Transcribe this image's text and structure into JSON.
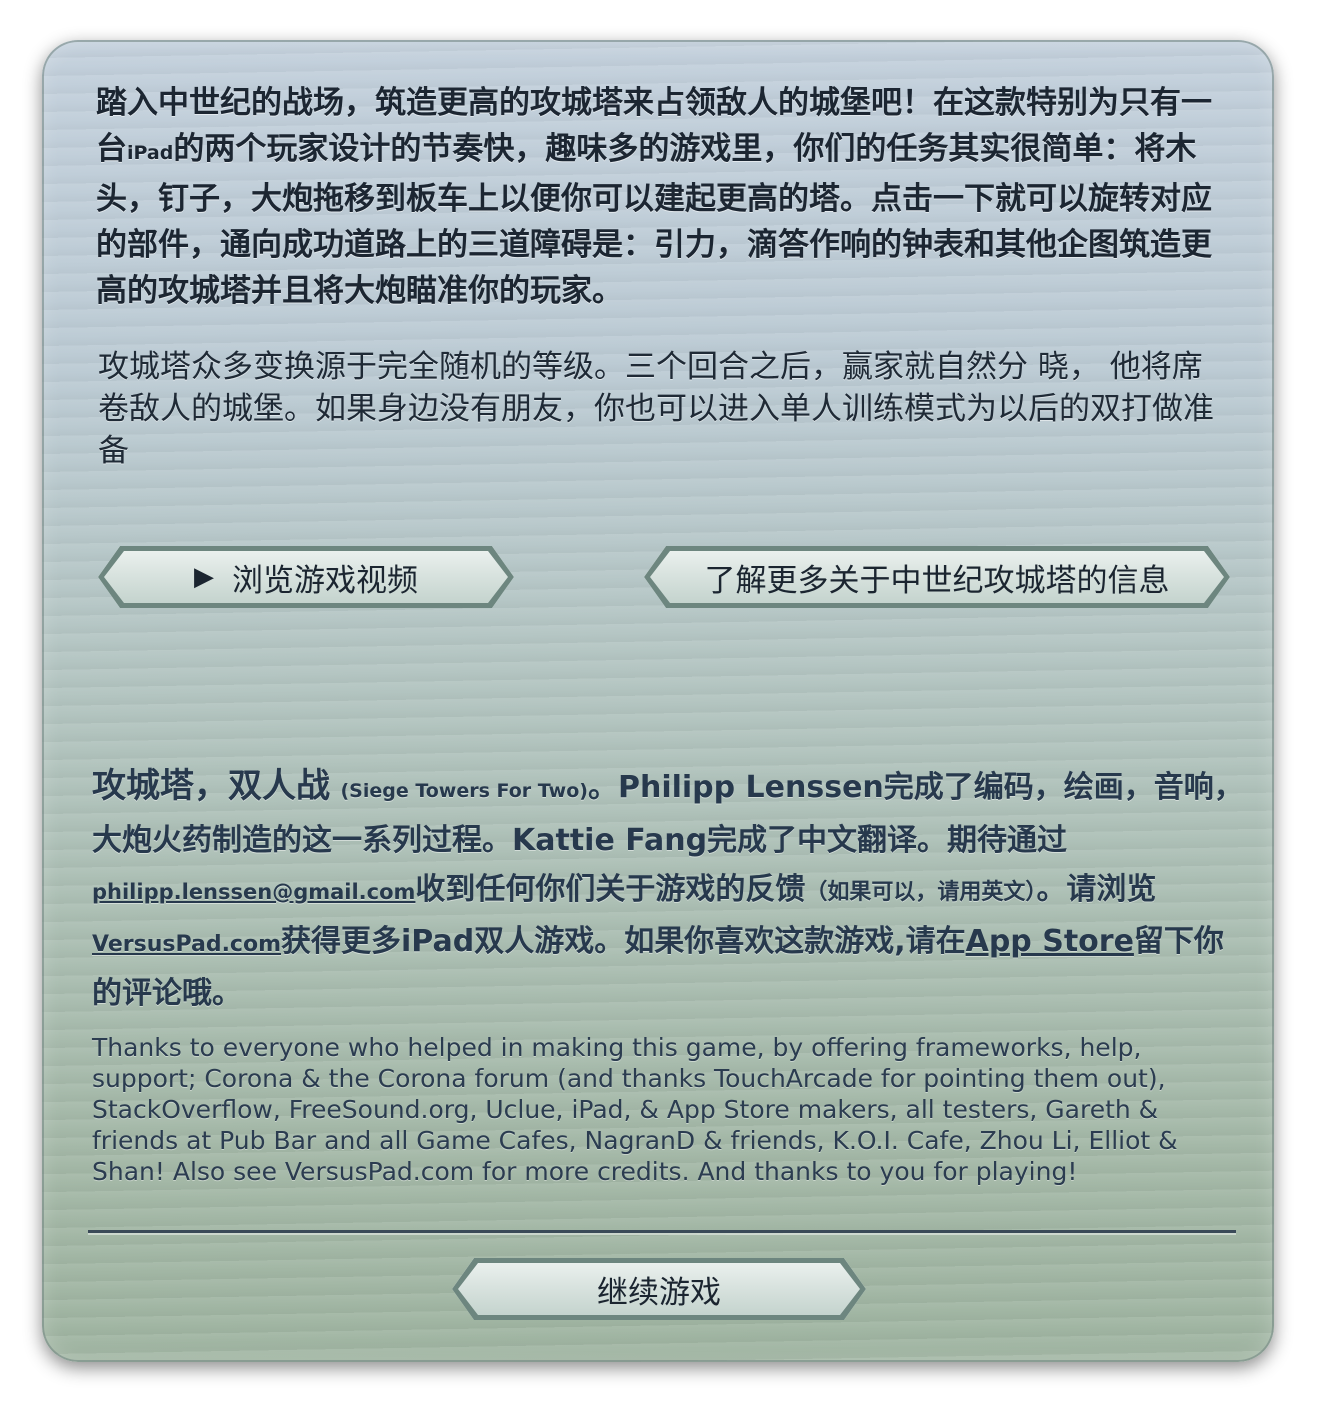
{
  "intro": {
    "bold_part1": "踏入中世纪的战场，筑造更高的攻城塔来占领敌人的城堡吧！在这款特别为只有一台",
    "bold_ipad": "iPad",
    "bold_part2": "的两个玩家设计的节奏快，趣味多的游戏里，你们的任务其实很简单：将木头，钉子，大炮拖移到板车上以便你可以建起更高的塔。点击一下就可以旋转对应的部件，通向成功道路上的三道障碍是：引力，滴答作响的钟表和其他企图筑造更高的攻城塔并且将大炮瞄准你的玩家。",
    "regular": "攻城塔众多变换源于完全随机的等级。三个回合之后，赢家就自然分 晓， 他将席卷敌人的城堡。如果身边没有朋友，你也可以进入单人训练模式为以后的双打做准备"
  },
  "buttons": {
    "video_icon": "▶",
    "video_label": "浏览游戏视频",
    "info_label": "了解更多关于中世纪攻城塔的信息",
    "continue_label": "继续游戏"
  },
  "credits": {
    "title": "攻城塔，双人战",
    "title_en": "(Siege Towers For Two)",
    "sentence1": "。Philipp Lenssen完成了编码，绘画，音响，大炮火药制造的这一系列过程。Kattie Fang完成了中文翻译。期待通过",
    "email": "philipp.lenssen@gmail.com",
    "sentence2": "收到任何你们关于游戏的反馈",
    "note": "（如果可以，请用英文）",
    "sentence3": "。请浏览",
    "site": "VersusPad.com",
    "sentence4": "获得更多iPad双人游戏。如果你喜欢这款游戏,请在",
    "appstore": "App Store",
    "sentence5": "留下你的评论哦。"
  },
  "thanks": "Thanks to everyone who helped in making this game, by offering frameworks, help, support; Corona & the Corona forum (and thanks TouchArcade for pointing them out), StackOverflow, FreeSound.org, Uclue, iPad, & App Store makers, all testers, Gareth & friends at Pub Bar and all Game Cafes, NagranD & friends, K.O.I. Cafe, Zhou Li, Elliot & Shan! Also see VersusPad.com for more credits. And thanks to you for playing!",
  "colors": {
    "panel_top": "#c3d0dc",
    "panel_bottom": "#a0b5a2",
    "text_dark": "#1c2632",
    "text_blue": "#27394d",
    "button_border": "#6d867f"
  }
}
